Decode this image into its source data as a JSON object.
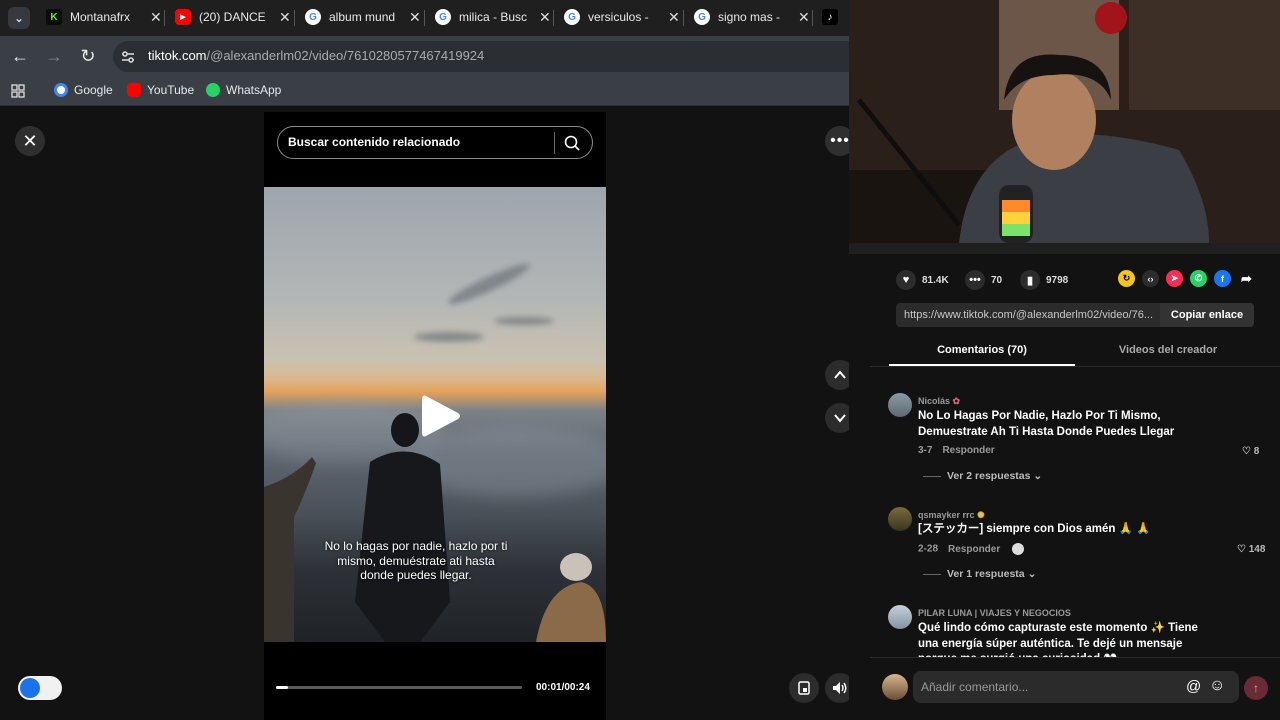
{
  "browser": {
    "tabs": [
      {
        "title": "Montanafrx",
        "icon": "kick-icon",
        "color": "#53fc18"
      },
      {
        "title": "(20) DANCE",
        "icon": "youtube-icon",
        "color": "#ff0000"
      },
      {
        "title": "album mund",
        "icon": "google-icon",
        "color": "#ffffff"
      },
      {
        "title": "milica - Busc",
        "icon": "google-icon",
        "color": "#ffffff"
      },
      {
        "title": "versiculos -",
        "icon": "google-icon",
        "color": "#ffffff"
      },
      {
        "title": "signo mas -",
        "icon": "google-icon",
        "color": "#ffffff"
      }
    ],
    "url_domain": "tiktok.com",
    "url_path": "/@alexanderlm02/video/7610280577467419924",
    "bookmarks": [
      {
        "label": "Google",
        "icon": "google-icon"
      },
      {
        "label": "YouTube",
        "icon": "youtube-icon"
      },
      {
        "label": "WhatsApp",
        "icon": "whatsapp-icon"
      }
    ]
  },
  "player": {
    "search_placeholder": "Buscar contenido relacionado",
    "caption": "No lo hagas por nadie, hazlo por ti mismo, demuéstrate ati hasta donde puedes llegar.",
    "time": "00:01/00:24",
    "progress_fraction": 0.05
  },
  "stats": {
    "likes": "81.4K",
    "comments": "70",
    "saves": "9798"
  },
  "share": {
    "link": "https://www.tiktok.com/@alexanderlm02/video/76...",
    "copy_label": "Copiar enlace"
  },
  "tabs": {
    "comments": "Comentarios (70)",
    "creator_videos": "Videos del creador"
  },
  "comments": [
    {
      "user": "Nicolás",
      "text": "No Lo Hagas Por Nadie, Hazlo Por Ti Mismo, Demuestrate Ah Ti Hasta Donde Puedes Llegar",
      "date": "3-7",
      "reply": "Responder",
      "likes": "8",
      "replies": "Ver 2 respuestas"
    },
    {
      "user": "qsmayker rrc",
      "text": "[ステッカー] siempre con Dios amén 🙏 🙏",
      "date": "2-28",
      "reply": "Responder",
      "likes": "148",
      "replies": "Ver 1 respuesta"
    },
    {
      "user": "PILAR LUNA | VIAJES Y NEGOCIOS",
      "text": "Qué lindo cómo capturaste este momento ✨ Tiene una energía súper auténtica. Te dejé un mensaje porque me surgió una curiosidad 👀"
    }
  ],
  "comment_box": {
    "placeholder": "Añadir comentario..."
  }
}
